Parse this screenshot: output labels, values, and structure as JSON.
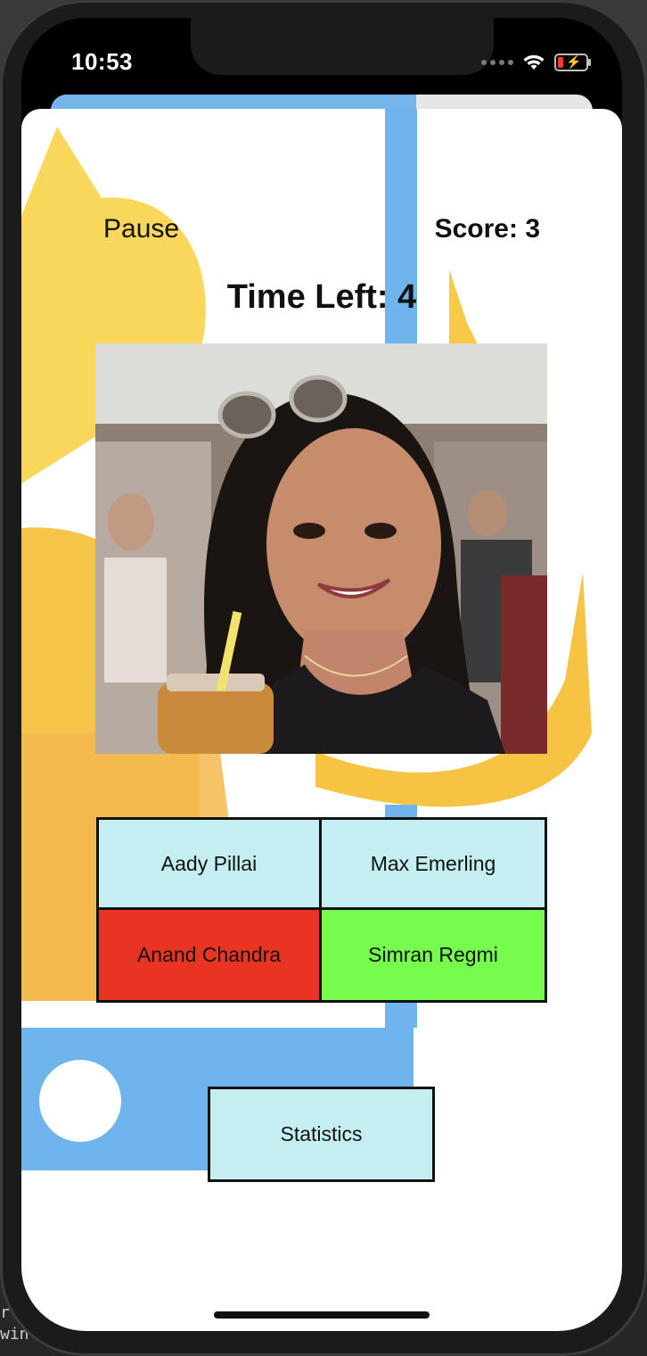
{
  "status_bar": {
    "time": "10:53",
    "battery_color": "#ff3b30"
  },
  "header": {
    "pause_label": "Pause",
    "score_label": "Score: 3"
  },
  "timer": {
    "label": "Time Left: 4"
  },
  "photo": {
    "icon": "person-photo"
  },
  "options": [
    {
      "label": "Aady Pillai",
      "color": "#c4eef2"
    },
    {
      "label": "Max Emerling",
      "color": "#c4eef2"
    },
    {
      "label": "Anand Chandra",
      "color": "#ea3423"
    },
    {
      "label": "Simran Regmi",
      "color": "#77fb4d"
    }
  ],
  "statistics": {
    "label": "Statistics",
    "color": "#c4eef2"
  },
  "colors": {
    "accent_blue": "#75b6ea",
    "accent_yellow": "#f7c948"
  },
  "desktop_terminal_text": [
    "r",
    "win"
  ]
}
